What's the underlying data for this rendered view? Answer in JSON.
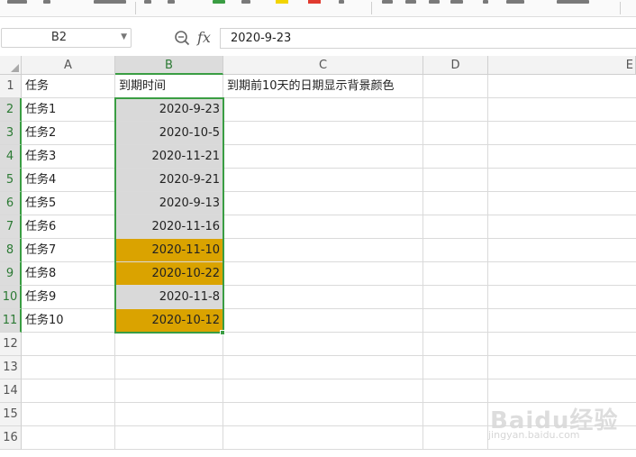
{
  "name_box": {
    "value": "B2"
  },
  "formula_bar": {
    "fx_label": "fx",
    "value": "2020-9-23"
  },
  "columns": [
    "A",
    "B",
    "C",
    "D",
    "E"
  ],
  "selected_column": "B",
  "selected_cell": "B2",
  "rows": [
    {
      "n": "1",
      "a": "任务",
      "b": "到期时间",
      "c": "到期前10天的日期显示背景颜色",
      "hl": false,
      "hdr": true
    },
    {
      "n": "2",
      "a": "任务1",
      "b": "2020-9-23",
      "c": "",
      "hl": false
    },
    {
      "n": "3",
      "a": "任务2",
      "b": "2020-10-5",
      "c": "",
      "hl": false
    },
    {
      "n": "4",
      "a": "任务3",
      "b": "2020-11-21",
      "c": "",
      "hl": false
    },
    {
      "n": "5",
      "a": "任务4",
      "b": "2020-9-21",
      "c": "",
      "hl": false
    },
    {
      "n": "6",
      "a": "任务5",
      "b": "2020-9-13",
      "c": "",
      "hl": false
    },
    {
      "n": "7",
      "a": "任务6",
      "b": "2020-11-16",
      "c": "",
      "hl": false
    },
    {
      "n": "8",
      "a": "任务7",
      "b": "2020-11-10",
      "c": "",
      "hl": true
    },
    {
      "n": "9",
      "a": "任务8",
      "b": "2020-10-22",
      "c": "",
      "hl": true
    },
    {
      "n": "10",
      "a": "任务9",
      "b": "2020-11-8",
      "c": "",
      "hl": false
    },
    {
      "n": "11",
      "a": "任务10",
      "b": "2020-10-12",
      "c": "",
      "hl": true
    },
    {
      "n": "12",
      "a": "",
      "b": "",
      "c": "",
      "hl": false,
      "empty": true
    },
    {
      "n": "13",
      "a": "",
      "b": "",
      "c": "",
      "hl": false,
      "empty": true
    },
    {
      "n": "14",
      "a": "",
      "b": "",
      "c": "",
      "hl": false,
      "empty": true
    },
    {
      "n": "15",
      "a": "",
      "b": "",
      "c": "",
      "hl": false,
      "empty": true
    },
    {
      "n": "16",
      "a": "",
      "b": "",
      "c": "",
      "hl": false,
      "empty": true
    }
  ],
  "colors": {
    "highlight": "#DAA300",
    "selection_fill": "#D9D9D9",
    "selection_border": "#3A9D43"
  },
  "watermark": {
    "text": "Baidu经验",
    "url": "jingyan.baidu.com"
  },
  "icons": [
    "zoom-formula-icon",
    "fx-icon",
    "dropdown-arrow-icon",
    "select-all-icon"
  ]
}
